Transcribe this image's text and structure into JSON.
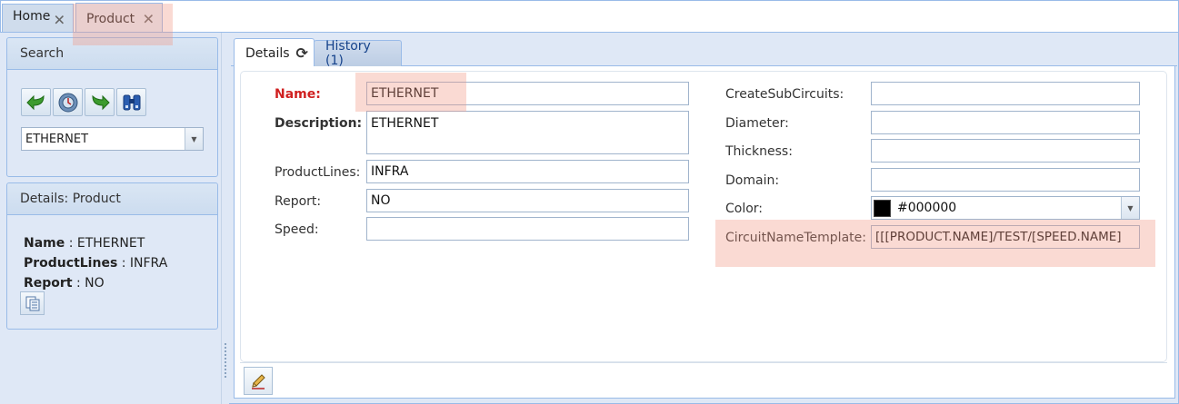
{
  "top_tabs": [
    {
      "label": "Home",
      "close": "✕"
    },
    {
      "label": "Product",
      "close": "✕"
    }
  ],
  "search_panel": {
    "title": "Search",
    "combo_value": "ETHERNET",
    "icons": [
      "back-arrow-icon",
      "settings-refresh-icon",
      "forward-arrow-icon",
      "binoculars-icon"
    ]
  },
  "details_panel": {
    "title": "Details: Product",
    "rows": [
      {
        "key": "Name",
        "sep": ":",
        "value": "ETHERNET"
      },
      {
        "key": "ProductLines",
        "sep": ":",
        "value": "INFRA"
      },
      {
        "key": "Report",
        "sep": ":",
        "value": "NO"
      }
    ]
  },
  "detail_tabs": {
    "details": "Details",
    "history": "History (1)"
  },
  "form_left": {
    "name_label": "Name:",
    "name_value": "ETHERNET",
    "description_label": "Description:",
    "description_value": "ETHERNET",
    "productlines_label": "ProductLines:",
    "productlines_value": "INFRA",
    "report_label": "Report:",
    "report_value": "NO",
    "speed_label": "Speed:",
    "speed_value": ""
  },
  "form_right": {
    "createsub_label": "CreateSubCircuits:",
    "createsub_value": "",
    "diameter_label": "Diameter:",
    "diameter_value": "",
    "thickness_label": "Thickness:",
    "thickness_value": "",
    "domain_label": "Domain:",
    "domain_value": "",
    "color_label": "Color:",
    "color_value": "#000000",
    "template_label": "CircuitNameTemplate:",
    "template_value": "[[[PRODUCT.NAME]/TEST/[SPEED.NAME]"
  },
  "colors": {
    "frame_border": "#99bbe8",
    "panel_bg": "#dfe8f6",
    "required_label": "#d02020",
    "highlight": "#f0968259"
  }
}
